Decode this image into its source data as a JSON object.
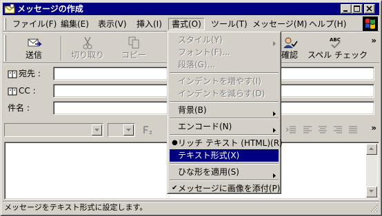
{
  "window": {
    "title": "メッセージの作成",
    "icon": "envelope-icon"
  },
  "title_buttons": [
    "minimize-icon",
    "maximize-icon",
    "close-icon"
  ],
  "menubar": {
    "items": [
      {
        "label": "ファイル(F)"
      },
      {
        "label": "編集(E)"
      },
      {
        "label": "表示(V)"
      },
      {
        "label": "挿入(I)"
      },
      {
        "label": "書式(O)"
      },
      {
        "label": "ツール(T)"
      },
      {
        "label": "メッセージ(M)"
      },
      {
        "label": "ヘルプ(H)"
      }
    ],
    "open_menu": "書式(O)"
  },
  "toolbar": {
    "send": {
      "label": "送信",
      "icon": "send-icon"
    },
    "cut": {
      "label": "切り取り",
      "icon": "scissors-icon"
    },
    "copy": {
      "label": "コピー",
      "icon": "copy-icon"
    },
    "check_names": {
      "label": "確認",
      "icon": "check-names-icon"
    },
    "spell_check": {
      "label": "スペル チェック",
      "icon": "spell-check-icon"
    },
    "more": "»"
  },
  "fields": {
    "to_label": "宛先 :",
    "cc_label": "CC :",
    "subject_label": "件名 :",
    "to_value": "",
    "cc_value": "",
    "subject_value": ""
  },
  "formatbar": {
    "more": "»"
  },
  "format_menu": {
    "items": [
      {
        "label": "スタイル(Y)",
        "state": "disabled",
        "submenu": true
      },
      {
        "label": "フォント(F)...",
        "state": "disabled"
      },
      {
        "label": "段落(G)...",
        "state": "disabled"
      },
      {
        "label": "インデントを増やす(I)",
        "state": "disabled"
      },
      {
        "label": "インデントを減らす(D)",
        "state": "disabled"
      },
      {
        "label": "背景(B)",
        "state": "enabled",
        "submenu": true
      },
      {
        "label": "エンコード(N)",
        "state": "enabled",
        "submenu": true
      },
      {
        "label": "リッチ テキスト (HTML)(R)",
        "state": "checked-radio"
      },
      {
        "label": "テキスト形式(X)",
        "state": "selected"
      },
      {
        "label": "ひな形を適用(S)",
        "state": "enabled",
        "submenu": true
      },
      {
        "label": "メッセージに画像を添付(P)",
        "state": "checked"
      }
    ]
  },
  "statusbar": {
    "text": "メッセージをテキスト形式に設定します。"
  },
  "colors": {
    "titlebar": "#000080",
    "face": "#d4d0c8",
    "highlight": "#000080"
  }
}
